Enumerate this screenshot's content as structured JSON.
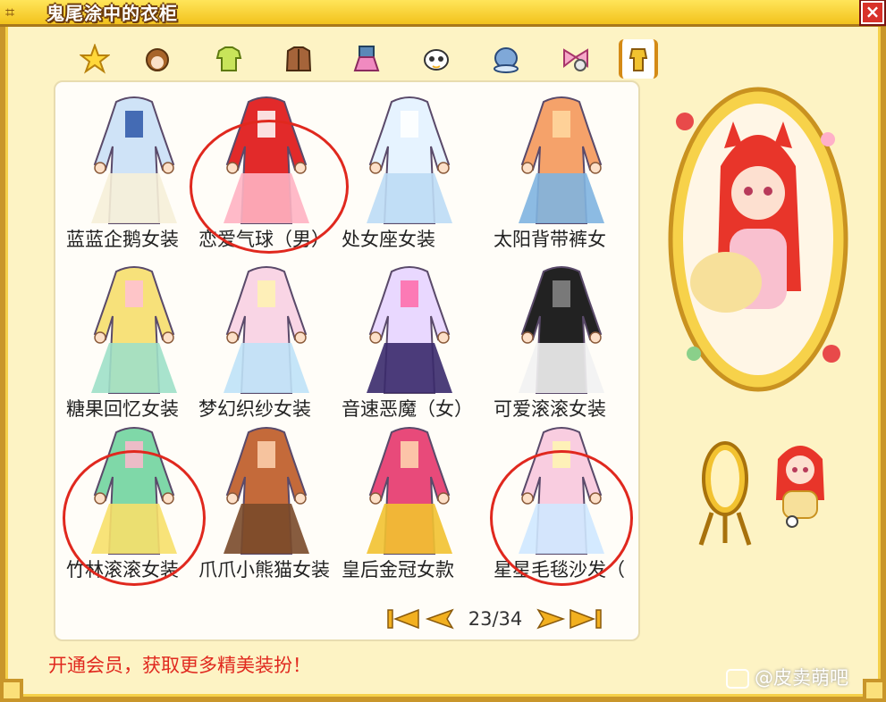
{
  "window": {
    "title": "鬼尾涂中的衣柜",
    "close_label": "×"
  },
  "tabs": [
    {
      "icon": "star-icon"
    },
    {
      "icon": "hair-icon"
    },
    {
      "icon": "shirt-icon"
    },
    {
      "icon": "jacket-icon"
    },
    {
      "icon": "skirt-icon"
    },
    {
      "icon": "face-icon"
    },
    {
      "icon": "hat-icon"
    },
    {
      "icon": "bow-icon"
    },
    {
      "icon": "full-outfit-icon",
      "active": true
    }
  ],
  "items": [
    {
      "label": "蓝蓝企鹅女装",
      "circled": false,
      "colors": [
        "#cfe3f7",
        "#f6f0d8",
        "#2c56a8"
      ]
    },
    {
      "label": "恋爱气球（男）",
      "circled": true,
      "colors": [
        "#e22a2a",
        "#ffb3c2",
        "#fff"
      ]
    },
    {
      "label": "处女座女装",
      "circled": false,
      "colors": [
        "#e6f3ff",
        "#bcdcf5",
        "#fff"
      ]
    },
    {
      "label": "太阳背带裤女",
      "circled": false,
      "colors": [
        "#f5a26a",
        "#7fb4e0",
        "#ffd9a0"
      ]
    },
    {
      "label": "糖果回忆女装",
      "circled": false,
      "colors": [
        "#f7e17a",
        "#9fe0c8",
        "#ffc0d6"
      ]
    },
    {
      "label": "梦幻织纱女装",
      "circled": false,
      "colors": [
        "#f9d5e5",
        "#bfe2f7",
        "#fff3b0"
      ]
    },
    {
      "label": "音速恶魔（女）",
      "circled": false,
      "colors": [
        "#e9d8ff",
        "#3a2a6b",
        "#ff6aa8"
      ]
    },
    {
      "label": "可爱滚滚女装",
      "circled": false,
      "colors": [
        "#222",
        "#f2f2f2",
        "#888"
      ]
    },
    {
      "label": "竹林滚滚女装",
      "circled": true,
      "colors": [
        "#7fd8a8",
        "#f7e06a",
        "#ffb7cc"
      ]
    },
    {
      "label": "爪爪小熊猫女装",
      "circled": false,
      "colors": [
        "#c46a3a",
        "#7a4a2a",
        "#ffd2b0"
      ]
    },
    {
      "label": "皇后金冠女款",
      "circled": false,
      "colors": [
        "#e84a7a",
        "#f2c230",
        "#ffd9b0"
      ]
    },
    {
      "label": "星星毛毯沙发（",
      "circled": true,
      "colors": [
        "#f9cde0",
        "#cfe8ff",
        "#fff7b0"
      ]
    }
  ],
  "pager": {
    "current": "23/34",
    "first_label": "first-page",
    "prev_label": "prev-page",
    "next_label": "next-page",
    "last_label": "last-page"
  },
  "promo": "开通会员，获取更多精美装扮！",
  "watermark": "@皮卖萌吧",
  "colors": {
    "accent": "#e0281e",
    "frame": "#c9962a",
    "title_bg": "#f2c21c"
  }
}
